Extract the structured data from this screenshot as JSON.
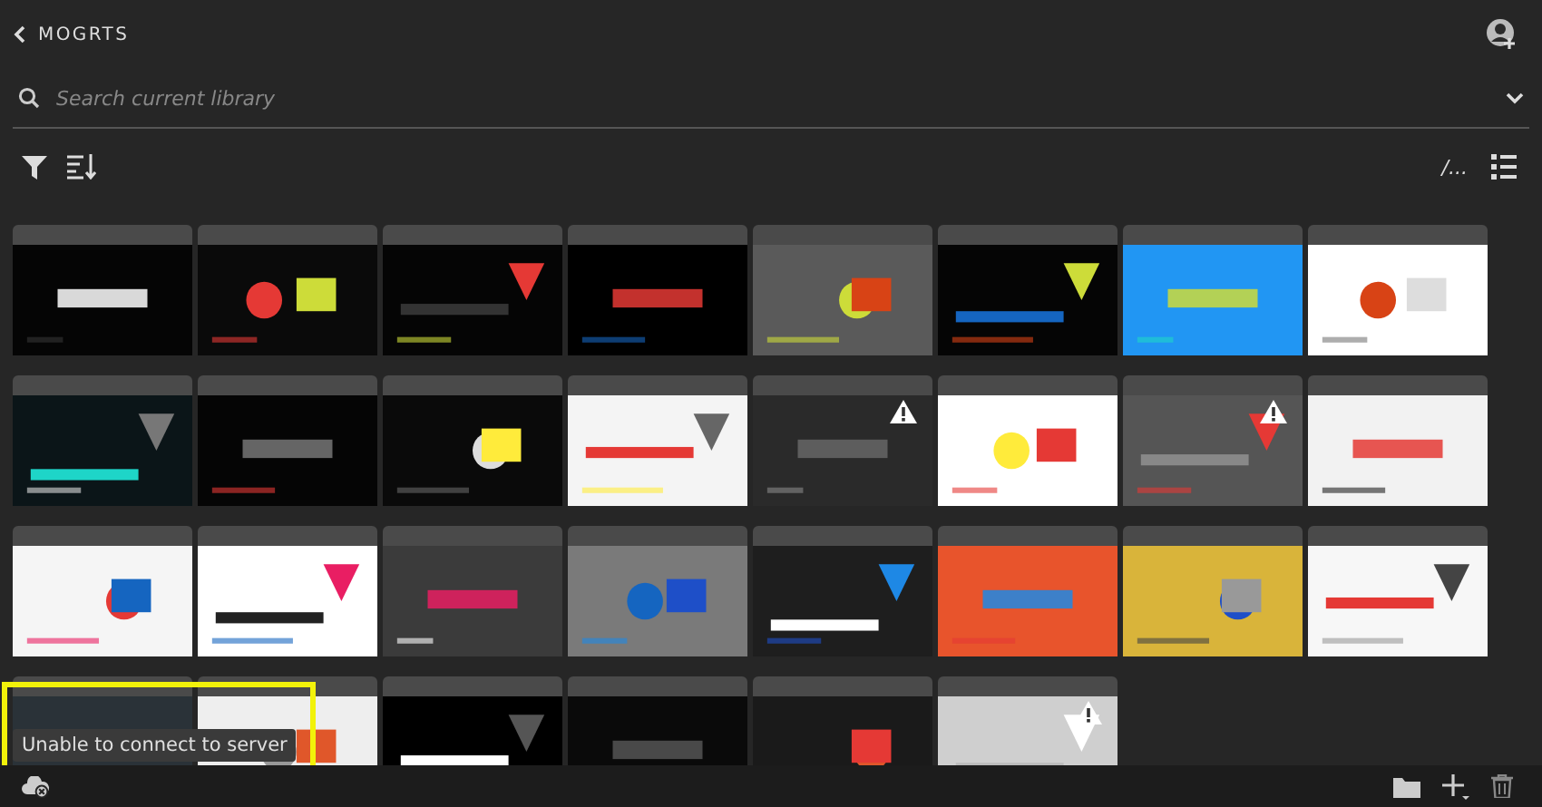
{
  "header": {
    "back_label": "MOGRTS"
  },
  "search": {
    "placeholder": "Search current library"
  },
  "toolbar": {
    "path": "/..."
  },
  "tiles": [
    {
      "kind": "picture",
      "warning": false
    },
    {
      "kind": "picture",
      "warning": false
    },
    {
      "kind": "picture",
      "warning": false
    },
    {
      "kind": "picture",
      "warning": false
    },
    {
      "kind": "picture",
      "warning": false
    },
    {
      "kind": "picture",
      "warning": false
    },
    {
      "kind": "picture",
      "warning": false
    },
    {
      "kind": "picture",
      "warning": false
    },
    {
      "kind": "picture",
      "warning": false
    },
    {
      "kind": "picture",
      "warning": false
    },
    {
      "kind": "picture",
      "warning": false
    },
    {
      "kind": "picture",
      "warning": false
    },
    {
      "kind": "picture",
      "warning": true
    },
    {
      "kind": "picture",
      "warning": false
    },
    {
      "kind": "picture",
      "warning": true
    },
    {
      "kind": "picture",
      "warning": false
    },
    {
      "kind": "picture",
      "warning": false
    },
    {
      "kind": "picture",
      "warning": false
    },
    {
      "kind": "picture",
      "warning": false
    },
    {
      "kind": "picture",
      "warning": false
    },
    {
      "kind": "picture",
      "warning": false
    },
    {
      "kind": "picture",
      "warning": false
    },
    {
      "kind": "picture",
      "warning": false
    },
    {
      "kind": "picture",
      "warning": false
    },
    {
      "kind": "picture",
      "warning": false
    },
    {
      "kind": "picture",
      "warning": false
    },
    {
      "kind": "picture",
      "warning": false
    },
    {
      "kind": "picture",
      "warning": false
    },
    {
      "kind": "picture",
      "warning": false
    },
    {
      "kind": "picture",
      "warning": true
    }
  ],
  "tooltip": "Unable to connect to server"
}
